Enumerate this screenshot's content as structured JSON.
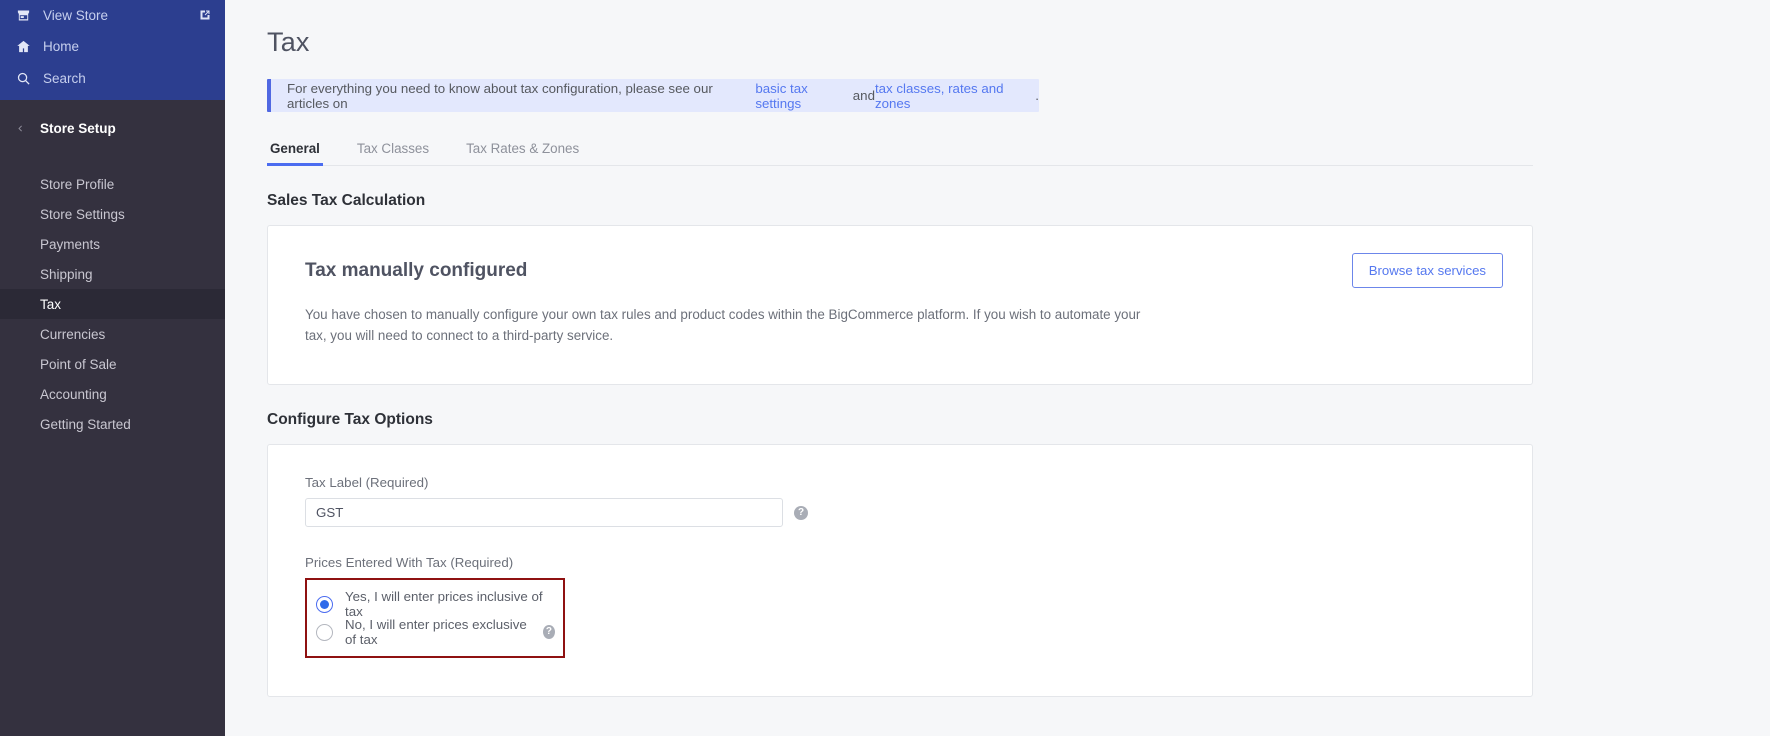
{
  "sidebar": {
    "top_items": [
      {
        "label": "View Store",
        "icon": "store-icon",
        "external": true,
        "external_icon": "external-link-icon"
      },
      {
        "label": "Home",
        "icon": "home-icon",
        "external": false
      },
      {
        "label": "Search",
        "icon": "search-icon",
        "external": false
      }
    ],
    "group": {
      "label": "Store Setup",
      "chevron": "chevron-left-icon"
    },
    "items": [
      {
        "label": "Store Profile",
        "active": false
      },
      {
        "label": "Store Settings",
        "active": false
      },
      {
        "label": "Payments",
        "active": false
      },
      {
        "label": "Shipping",
        "active": false
      },
      {
        "label": "Tax",
        "active": true
      },
      {
        "label": "Currencies",
        "active": false
      },
      {
        "label": "Point of Sale",
        "active": false
      },
      {
        "label": "Accounting",
        "active": false
      },
      {
        "label": "Getting Started",
        "active": false
      }
    ],
    "colors": {
      "top_bg": "#2c3e8f",
      "bg": "#34313f",
      "active_bg": "#2b2936"
    }
  },
  "page": {
    "title": "Tax"
  },
  "banner": {
    "text_before": "For everything you need to know about tax configuration, please see our articles on ",
    "link1": "basic tax settings",
    "text_middle": " and ",
    "link2": "tax classes, rates and zones",
    "text_after": ".",
    "accent_color": "#5068e2",
    "bg_color": "#e3e8fd"
  },
  "tabs": [
    {
      "label": "General",
      "active": true
    },
    {
      "label": "Tax Classes",
      "active": false
    },
    {
      "label": "Tax Rates & Zones",
      "active": false
    }
  ],
  "sales_tax_calculation": {
    "section_title": "Sales Tax Calculation",
    "card_title": "Tax manually configured",
    "card_body": "You have chosen to manually configure your own tax rules and product codes within the BigCommerce platform. If you wish to automate your tax, you will need to connect to a third-party service.",
    "browse_button": "Browse tax services"
  },
  "configure_tax_options": {
    "section_title": "Configure Tax Options",
    "tax_label": {
      "label": "Tax Label (Required)",
      "value": "GST",
      "placeholder": "",
      "help_icon": "question-mark-icon"
    },
    "prices_entered_with_tax": {
      "label": "Prices Entered With Tax (Required)",
      "highlight_color": "#8f1111",
      "options": [
        {
          "label": "Yes, I will enter prices inclusive of tax",
          "selected": true,
          "help": false
        },
        {
          "label": "No, I will enter prices exclusive of tax",
          "selected": false,
          "help": true,
          "help_icon": "question-mark-icon"
        }
      ]
    }
  }
}
